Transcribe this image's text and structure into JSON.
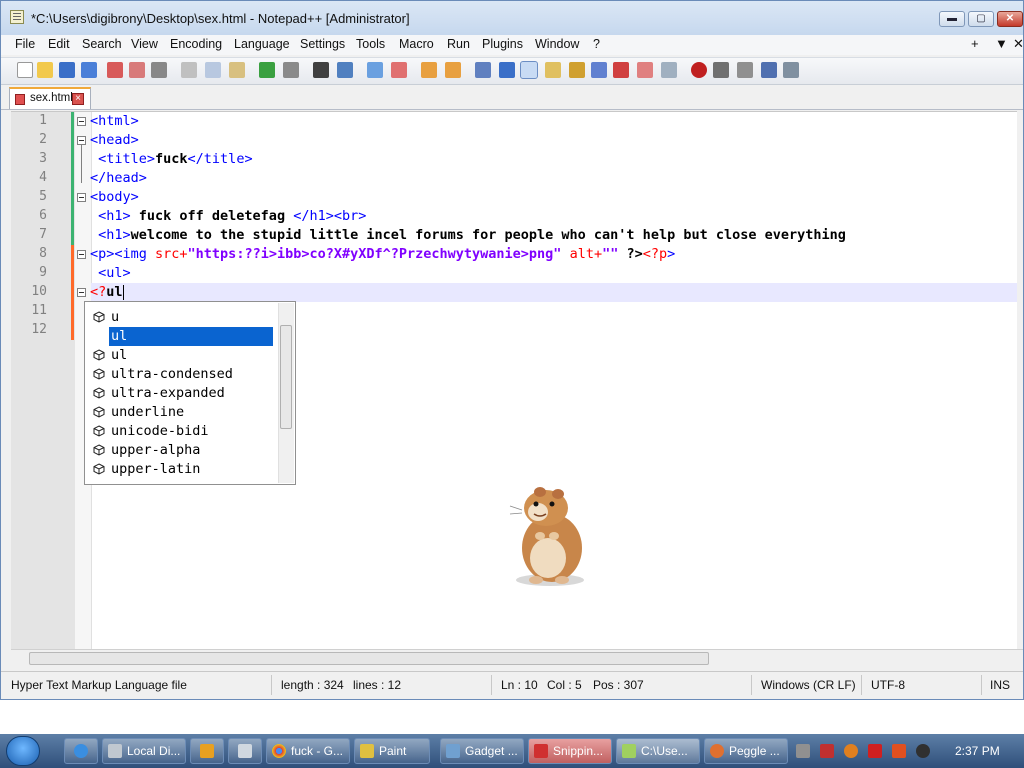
{
  "window": {
    "title": "*C:\\Users\\digibrony\\Desktop\\sex.html - Notepad++ [Administrator]",
    "controls": {
      "minimize": "▬",
      "maximize": "▢",
      "close": "✕"
    }
  },
  "menu": {
    "items": [
      "File",
      "Edit",
      "Search",
      "View",
      "Encoding",
      "Language",
      "Settings",
      "Tools",
      "Macro",
      "Run",
      "Plugins",
      "Window",
      "?"
    ],
    "right": [
      "+",
      "▼",
      "✕"
    ]
  },
  "tab": {
    "label": "sex.html"
  },
  "editor": {
    "line_numbers": [
      "1",
      "2",
      "3",
      "4",
      "5",
      "6",
      "7",
      "8",
      "9",
      "10",
      "11",
      "12"
    ],
    "lines": [
      [
        {
          "t": "tag",
          "v": "<html>"
        }
      ],
      [
        {
          "t": "tag",
          "v": "<head>"
        }
      ],
      [
        {
          "t": "tag",
          "v": " <title>"
        },
        {
          "t": "txt",
          "v": "fuck"
        },
        {
          "t": "tag",
          "v": "</title>"
        }
      ],
      [
        {
          "t": "tag",
          "v": "</head>"
        }
      ],
      [
        {
          "t": "tag",
          "v": "<body>"
        }
      ],
      [
        {
          "t": "tag",
          "v": " <h1>"
        },
        {
          "t": "txt",
          "v": " fuck off deletefag "
        },
        {
          "t": "tag",
          "v": "</h1><br>"
        }
      ],
      [
        {
          "t": "tag",
          "v": " <h1>"
        },
        {
          "t": "txt",
          "v": "welcome to the stupid little incel forums for people who can't help but close everything"
        }
      ],
      [
        {
          "t": "tag",
          "v": "<p><img "
        },
        {
          "t": "attr",
          "v": "src+"
        },
        {
          "t": "str",
          "v": "\"https:??i>ibb>co?X#yXDf^?Przechwytywanie>png\""
        },
        {
          "t": "txt",
          "v": " "
        },
        {
          "t": "attr",
          "v": "alt+"
        },
        {
          "t": "str",
          "v": "\"\""
        },
        {
          "t": "txt",
          "v": " ?>"
        },
        {
          "t": "qm",
          "v": "<?p"
        },
        {
          "t": "tag",
          "v": ">"
        }
      ],
      [
        {
          "t": "tag",
          "v": " <ul>"
        }
      ],
      [
        {
          "t": "qm",
          "v": "<?"
        },
        {
          "t": "txt",
          "v": "ul"
        }
      ],
      [],
      []
    ]
  },
  "autocomplete": {
    "items": [
      "u",
      "ul",
      "ul",
      "ultra-condensed",
      "ultra-expanded",
      "underline",
      "unicode-bidi",
      "upper-alpha",
      "upper-latin"
    ],
    "selected_index": 1
  },
  "status": {
    "file_type": "Hyper Text Markup Language file",
    "length": "length : 324",
    "lines": "lines : 12",
    "ln": "Ln : 10",
    "col": "Col : 5",
    "pos": "Pos : 307",
    "eol": "Windows (CR LF)",
    "encoding": "UTF-8",
    "mode": "INS"
  },
  "taskbar": {
    "items": [
      "Local Di...",
      "fuck - G...",
      "Paint",
      "Gadget ...",
      "Snippin...",
      "C:\\Use...",
      "Peggle ..."
    ],
    "clock": "2:37 PM"
  },
  "colors": {
    "tag": "#0000ff",
    "attribute": "#ff0000",
    "string": "#8000ff",
    "selection": "#0a64d0",
    "current_line": "#e8e8ff"
  }
}
